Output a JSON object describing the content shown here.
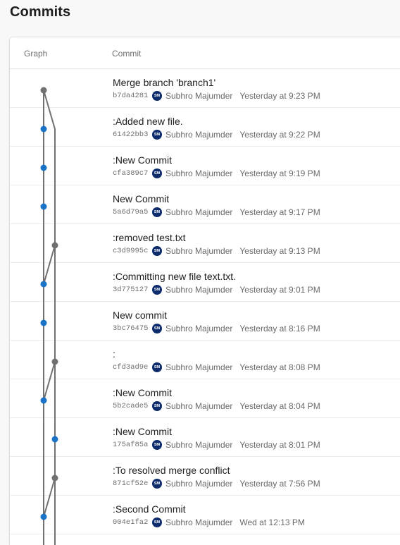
{
  "page": {
    "title": "Commits"
  },
  "table": {
    "graph_header": "Graph",
    "commit_header": "Commit"
  },
  "colors": {
    "head_node": "#707070",
    "branch_node": "#1a73c6",
    "edge": "#707070",
    "avatar_bg": "#0d2c6b"
  },
  "commits": [
    {
      "message": "Merge branch 'branch1'",
      "hash": "b7da4281",
      "avatar": "SM",
      "author": "Subhro Majumder",
      "time": "Yesterday at 9:23 PM",
      "lane": 0,
      "node": "gray"
    },
    {
      "message": ":Added new file.",
      "hash": "61422bb3",
      "avatar": "SM",
      "author": "Subhro Majumder",
      "time": "Yesterday at 9:22 PM",
      "lane": 0,
      "node": "blue"
    },
    {
      "message": ":New Commit",
      "hash": "cfa389c7",
      "avatar": "SM",
      "author": "Subhro Majumder",
      "time": "Yesterday at 9:19 PM",
      "lane": 0,
      "node": "blue"
    },
    {
      "message": "New Commit",
      "hash": "5a6d79a5",
      "avatar": "SM",
      "author": "Subhro Majumder",
      "time": "Yesterday at 9:17 PM",
      "lane": 0,
      "node": "blue"
    },
    {
      "message": ":removed test.txt",
      "hash": "c3d9995c",
      "avatar": "SM",
      "author": "Subhro Majumder",
      "time": "Yesterday at 9:13 PM",
      "lane": 1,
      "node": "gray"
    },
    {
      "message": ":Committing new file text.txt.",
      "hash": "3d775127",
      "avatar": "SM",
      "author": "Subhro Majumder",
      "time": "Yesterday at 9:01 PM",
      "lane": 0,
      "node": "blue"
    },
    {
      "message": "New commit",
      "hash": "3bc76475",
      "avatar": "SM",
      "author": "Subhro Majumder",
      "time": "Yesterday at 8:16 PM",
      "lane": 0,
      "node": "blue"
    },
    {
      "message": ":",
      "hash": "cfd3ad9e",
      "avatar": "SM",
      "author": "Subhro Majumder",
      "time": "Yesterday at 8:08 PM",
      "lane": 1,
      "node": "gray"
    },
    {
      "message": ":New Commit",
      "hash": "5b2cade5",
      "avatar": "SM",
      "author": "Subhro Majumder",
      "time": "Yesterday at 8:04 PM",
      "lane": 0,
      "node": "blue"
    },
    {
      "message": ":New Commit",
      "hash": "175af85a",
      "avatar": "SM",
      "author": "Subhro Majumder",
      "time": "Yesterday at 8:01 PM",
      "lane": 1,
      "node": "blue"
    },
    {
      "message": ":To resolved merge conflict",
      "hash": "871cf52e",
      "avatar": "SM",
      "author": "Subhro Majumder",
      "time": "Yesterday at 7:56 PM",
      "lane": 1,
      "node": "gray"
    },
    {
      "message": ":Second Commit",
      "hash": "004e1fa2",
      "avatar": "SM",
      "author": "Subhro Majumder",
      "time": "Wed at 12:13 PM",
      "lane": 0,
      "node": "blue"
    }
  ]
}
